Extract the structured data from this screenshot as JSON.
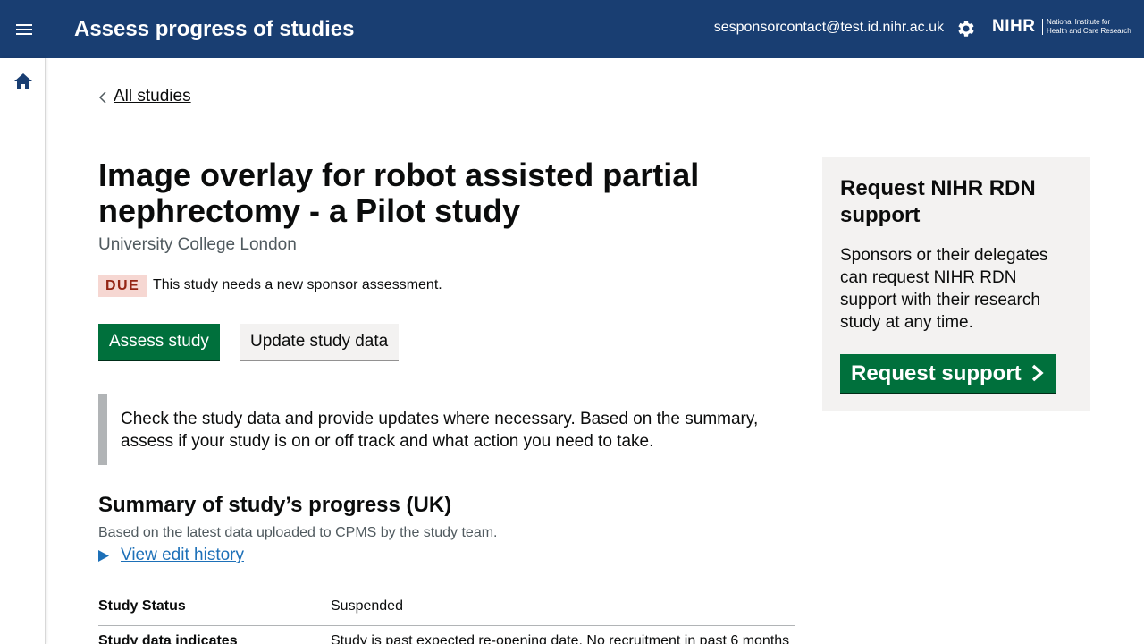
{
  "header": {
    "title": "Assess progress of studies",
    "user_email": "sesponsorcontact@test.id.nihr.ac.uk",
    "logo_text": "NIHR",
    "logo_subtext_line1": "National Institute for",
    "logo_subtext_line2": "Health and Care Research"
  },
  "nav": {
    "back_link": "All studies"
  },
  "study": {
    "title": "Image overlay for robot assisted partial nephrectomy - a Pilot study",
    "organisation": "University College London",
    "status_tag": "DUE",
    "status_message": "This study needs a new sponsor assessment.",
    "assess_button": "Assess study",
    "update_button": "Update study data",
    "inset_text": "Check the study data and provide updates where necessary. Based on the summary, assess if your study is on or off track and what action you need to take."
  },
  "summary": {
    "heading": "Summary of study’s progress (UK)",
    "subtext": "Based on the latest data uploaded to CPMS by the study team.",
    "details_link": "View edit history",
    "rows": [
      {
        "key": "Study Status",
        "value": "Suspended"
      },
      {
        "key": "Study data indicates",
        "value": "Study is past expected re-opening date. No recruitment in past 6 months"
      }
    ]
  },
  "sidebar": {
    "heading": "Request NIHR RDN support",
    "body": "Sponsors or their delegates can request NIHR RDN support with their research study at any time.",
    "button": "Request support"
  },
  "colors": {
    "header_bg": "#193e72",
    "primary_button": "#00703c",
    "link": "#1d70b8",
    "tag_bg": "#f6d7d2",
    "tag_text": "#942514",
    "panel_bg": "#f3f2f1"
  },
  "icons": {
    "menu": "menu-icon",
    "settings": "gear-icon",
    "home": "home-icon",
    "back": "chevron-left-icon",
    "details": "triangle-right-icon",
    "start": "chevron-right-icon"
  }
}
